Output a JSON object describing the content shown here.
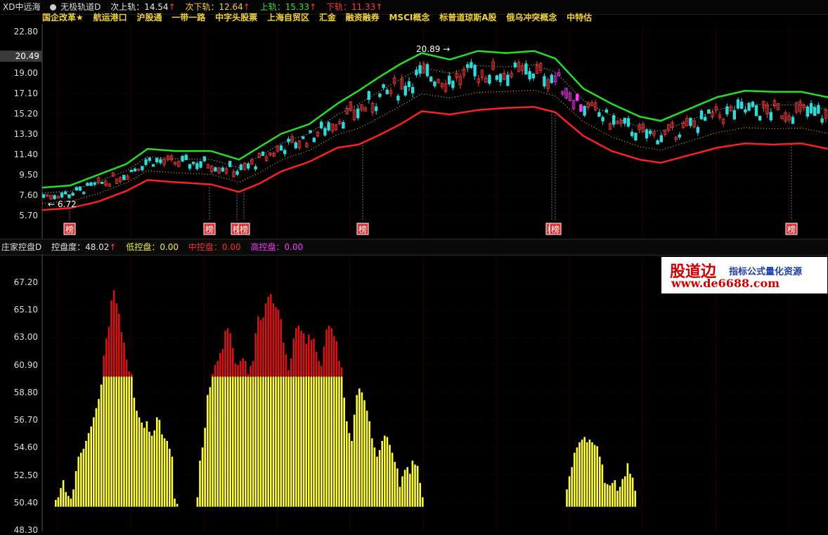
{
  "top": {
    "symbol": "XD中远海",
    "indicator": "无极轨道D",
    "fields": [
      {
        "label": "次上轨：14.54",
        "arrow": "↑",
        "color": "#e8e8e8"
      },
      {
        "label": "次下轨：12.64",
        "arrow": "↑",
        "color": "#f2d33a"
      },
      {
        "label": "上轨：15.33",
        "arrow": "↑",
        "color": "#38e038"
      },
      {
        "label": "下轨：11.33",
        "arrow": "↑",
        "color": "#ff3b3b"
      }
    ]
  },
  "tags": [
    "国企改革★",
    "航运港口",
    "沪股通",
    "一带一路",
    "中字头股票",
    "上海自贸区",
    "汇金",
    "融资融券",
    "MSCI概念",
    "标普道琼斯A股",
    "俄乌冲突概念",
    "中特估"
  ],
  "price_axis": [
    "22.80",
    "20.49",
    "19.00",
    "17.10",
    "15.20",
    "13.30",
    "11.40",
    "9.50",
    "7.60",
    "5.70"
  ],
  "current_price": "20.49",
  "annotations": {
    "high": "20.89",
    "low": "6.72"
  },
  "bang_label": "榜",
  "sub": {
    "name": "庄家控盘D",
    "fields": [
      {
        "label": "控盘度：48.02",
        "arrow": "↑",
        "color": "#e0e0e0"
      },
      {
        "label": "低控盘：0.00",
        "arrow": "",
        "color": "#f2f23a"
      },
      {
        "label": "中控盘：0.00",
        "arrow": "",
        "color": "#ff2a2a"
      },
      {
        "label": "高控盘：0.00",
        "arrow": "",
        "color": "#ff33ff"
      }
    ]
  },
  "sub_axis": [
    "67.20",
    "65.10",
    "63.00",
    "60.90",
    "58.80",
    "56.70",
    "54.60",
    "52.50",
    "50.40",
    "48.30"
  ],
  "logo": {
    "title": "股道边",
    "subtitle": "指标公式量化资源",
    "url": "www.de6688.com"
  },
  "colors": {
    "up": "#ff3b3b",
    "down": "#2fd9d9",
    "upper_band": "#22e022",
    "lower_band": "#ff2020",
    "low_ctrl": "#ffff40",
    "mid_ctrl": "#d41414"
  },
  "chart_data": {
    "type": "bar",
    "title": "庄家控盘D",
    "ylim": [
      48.3,
      67.2
    ],
    "threshold": 60.0,
    "values": [
      50.6,
      50.8,
      51.5,
      52.1,
      51.2,
      50.9,
      50.7,
      51.4,
      52.8,
      53.9,
      54.2,
      54.5,
      55.1,
      55.7,
      56.2,
      56.9,
      57.6,
      58.3,
      59.4,
      61.6,
      62.9,
      63.8,
      65.8,
      66.6,
      65.6,
      64.8,
      63.4,
      62.6,
      61.3,
      60.4,
      60.2,
      58.4,
      57.4,
      56.9,
      56.5,
      56.1,
      56.6,
      55.8,
      55.5,
      55.9,
      56.9,
      56.7,
      55.6,
      55.3,
      55.1,
      54.5,
      53.9,
      50.7,
      50.3,
      null,
      null,
      null,
      null,
      null,
      null,
      null,
      50.8,
      53.6,
      54.6,
      56.1,
      58.6,
      59.2,
      60.2,
      60.9,
      61.2,
      61.8,
      62.1,
      63.5,
      63.7,
      63.3,
      62.2,
      61.0,
      60.9,
      61.2,
      61.4,
      61.2,
      60.2,
      60.8,
      61.2,
      63.3,
      64.6,
      64.3,
      64.5,
      65.6,
      66.1,
      66.3,
      65.6,
      65.3,
      65.1,
      64.4,
      62.6,
      61.7,
      60.5,
      61.4,
      62.9,
      63.7,
      63.9,
      63.5,
      63.3,
      62.5,
      63.2,
      62.8,
      62.9,
      61.9,
      61.2,
      60.8,
      62.3,
      63.6,
      63.9,
      63.7,
      63.1,
      62.7,
      61.2,
      60.7,
      58.4,
      56.6,
      55.7,
      55.1,
      57.1,
      58.6,
      59.1,
      58.8,
      58.2,
      57.4,
      56.6,
      55.3,
      54.6,
      53.9,
      54.4,
      55.1,
      55.5,
      55.4,
      54.8,
      54.2,
      53.5,
      53.0,
      51.6,
      52.4,
      52.9,
      53.1,
      52.6,
      53.6,
      53.3,
      53.2,
      51.9,
      50.8,
      null,
      null,
      null,
      null,
      null,
      null,
      null,
      null,
      null,
      null,
      null,
      null,
      null,
      null,
      null,
      null,
      null,
      null,
      null,
      null,
      null,
      null,
      null,
      null,
      null,
      null,
      null,
      null,
      null,
      null,
      null,
      null,
      null,
      null,
      null,
      null,
      null,
      null,
      null,
      null,
      null,
      null,
      null,
      null,
      null,
      null,
      null,
      null,
      null,
      null,
      null,
      null,
      null,
      null,
      null,
      null,
      51.4,
      52.4,
      53.1,
      54.2,
      54.6,
      55.0,
      55.2,
      55.4,
      55.0,
      55.2,
      55.0,
      54.8,
      54.7,
      53.9,
      53.3,
      51.9,
      51.8,
      51.7,
      51.9,
      52.1,
      51.3,
      51.6,
      52.2,
      52.4,
      53.4,
      52.6,
      52.3,
      51.3
    ]
  }
}
